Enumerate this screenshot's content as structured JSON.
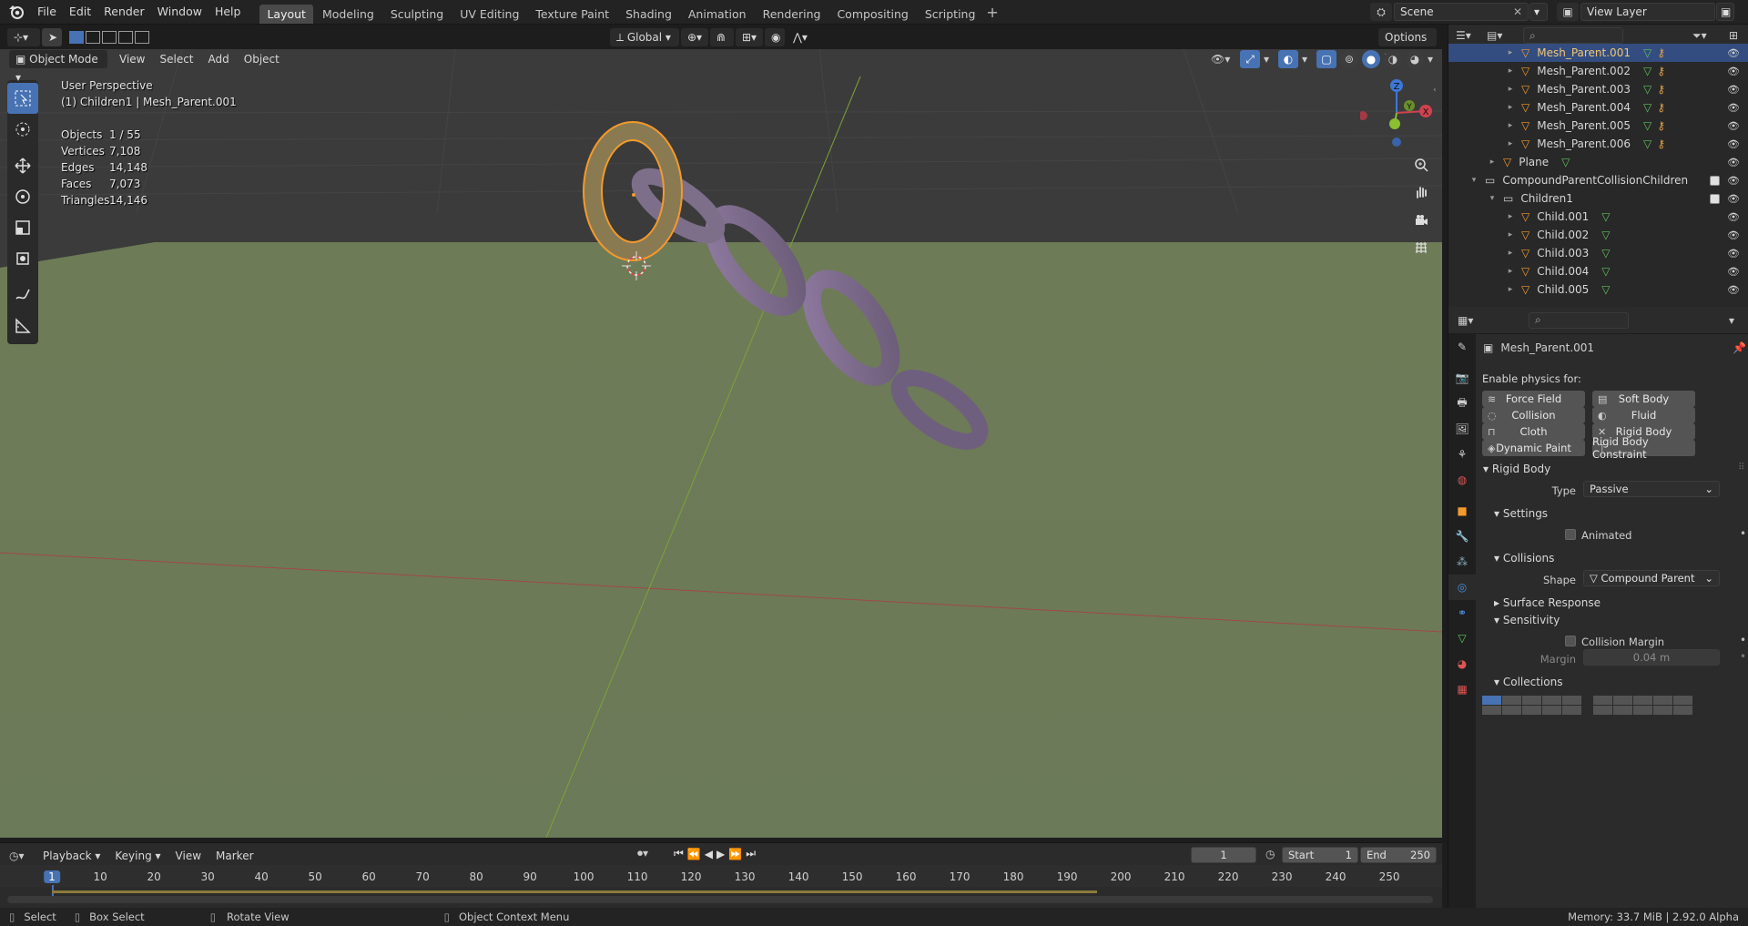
{
  "menu": [
    "File",
    "Edit",
    "Render",
    "Window",
    "Help"
  ],
  "workspaces": [
    "Layout",
    "Modeling",
    "Sculpting",
    "UV Editing",
    "Texture Paint",
    "Shading",
    "Animation",
    "Rendering",
    "Compositing",
    "Scripting"
  ],
  "active_workspace": "Layout",
  "scene": "Scene",
  "view_layer": "View Layer",
  "viewport": {
    "mode": "Object Mode",
    "menus": [
      "View",
      "Select",
      "Add",
      "Object"
    ],
    "transform_orientation": "Global",
    "options_label": "Options",
    "perspective_label": "User Perspective",
    "collection_label": "(1) Children1 | Mesh_Parent.001",
    "stats": [
      {
        "label": "Objects",
        "value": "1 / 55"
      },
      {
        "label": "Vertices",
        "value": "7,108"
      },
      {
        "label": "Edges",
        "value": "14,148"
      },
      {
        "label": "Faces",
        "value": "7,073"
      },
      {
        "label": "Triangles",
        "value": "14,146"
      }
    ],
    "gizmo": {
      "x": "X",
      "y": "Y",
      "z": "Z"
    }
  },
  "outliner": {
    "rows": [
      {
        "name": "Mesh_Parent.001",
        "indent": 2,
        "selected": true,
        "type": "mesh"
      },
      {
        "name": "Mesh_Parent.002",
        "indent": 2,
        "selected": false,
        "type": "mesh"
      },
      {
        "name": "Mesh_Parent.003",
        "indent": 2,
        "selected": false,
        "type": "mesh"
      },
      {
        "name": "Mesh_Parent.004",
        "indent": 2,
        "selected": false,
        "type": "mesh"
      },
      {
        "name": "Mesh_Parent.005",
        "indent": 2,
        "selected": false,
        "type": "mesh"
      },
      {
        "name": "Mesh_Parent.006",
        "indent": 2,
        "selected": false,
        "type": "mesh"
      },
      {
        "name": "Plane",
        "indent": 1,
        "selected": false,
        "type": "mesh"
      },
      {
        "name": "CompoundParentCollisionChildren",
        "indent": 0,
        "selected": false,
        "type": "collection"
      },
      {
        "name": "Children1",
        "indent": 1,
        "selected": false,
        "type": "collection"
      },
      {
        "name": "Child.001",
        "indent": 2,
        "selected": false,
        "type": "mesh"
      },
      {
        "name": "Child.002",
        "indent": 2,
        "selected": false,
        "type": "mesh"
      },
      {
        "name": "Child.003",
        "indent": 2,
        "selected": false,
        "type": "mesh"
      },
      {
        "name": "Child.004",
        "indent": 2,
        "selected": false,
        "type": "mesh"
      },
      {
        "name": "Child.005",
        "indent": 2,
        "selected": false,
        "type": "mesh"
      }
    ]
  },
  "properties": {
    "object_name": "Mesh_Parent.001",
    "enable_physics_label": "Enable physics for:",
    "physics_buttons": [
      "Force Field",
      "Soft Body",
      "Collision",
      "Fluid",
      "Cloth",
      "Rigid Body",
      "Dynamic Paint",
      "Rigid Body Constraint"
    ],
    "rigid_body_panel": "Rigid Body",
    "type_label": "Type",
    "type_value": "Passive",
    "settings_panel": "Settings",
    "animated_label": "Animated",
    "collisions_panel": "Collisions",
    "shape_label": "Shape",
    "shape_value": "Compound Parent",
    "surface_response_panel": "Surface Response",
    "sensitivity_panel": "Sensitivity",
    "collision_margin_label": "Collision Margin",
    "margin_label": "Margin",
    "margin_value": "0.04 m",
    "collections_panel": "Collections"
  },
  "timeline": {
    "menus": [
      "Playback",
      "Keying",
      "View",
      "Marker"
    ],
    "current_frame": "1",
    "start_label": "Start",
    "start_value": "1",
    "end_label": "End",
    "end_value": "250",
    "ticks": [
      "1",
      "10",
      "20",
      "30",
      "40",
      "50",
      "60",
      "70",
      "80",
      "90",
      "100",
      "110",
      "120",
      "130",
      "140",
      "150",
      "160",
      "170",
      "180",
      "190",
      "200",
      "210",
      "220",
      "230",
      "240",
      "250"
    ]
  },
  "statusbar": {
    "select": "Select",
    "box_select": "Box Select",
    "rotate_view": "Rotate View",
    "context_menu": "Object Context Menu",
    "memory": "Memory: 33.7 MiB | 2.92.0 Alpha"
  }
}
